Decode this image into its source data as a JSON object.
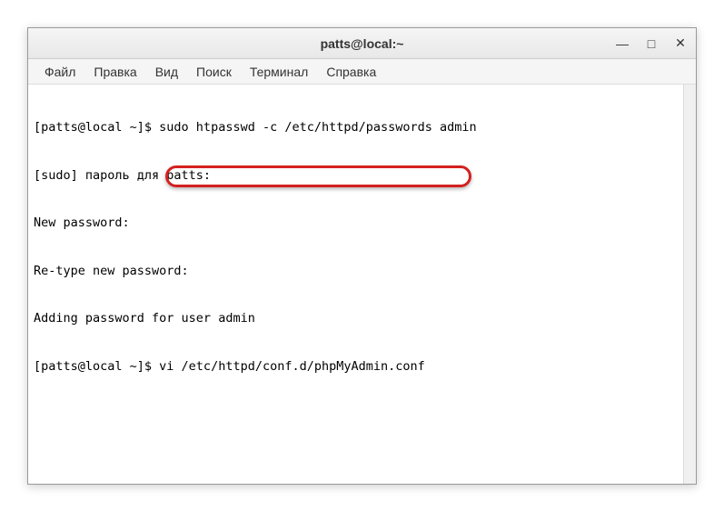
{
  "window": {
    "title": "patts@local:~"
  },
  "menubar": {
    "file": "Файл",
    "edit": "Правка",
    "view": "Вид",
    "search": "Поиск",
    "terminal": "Терминал",
    "help": "Справка"
  },
  "terminal": {
    "lines": [
      "[patts@local ~]$ sudo htpasswd -c /etc/httpd/passwords admin",
      "[sudo] пароль для patts:",
      "New password:",
      "Re-type new password:",
      "Adding password for user admin",
      "[patts@local ~]$ vi /etc/httpd/conf.d/phpMyAdmin.conf"
    ]
  },
  "controls": {
    "minimize": "—",
    "maximize": "□",
    "close": "✕"
  }
}
